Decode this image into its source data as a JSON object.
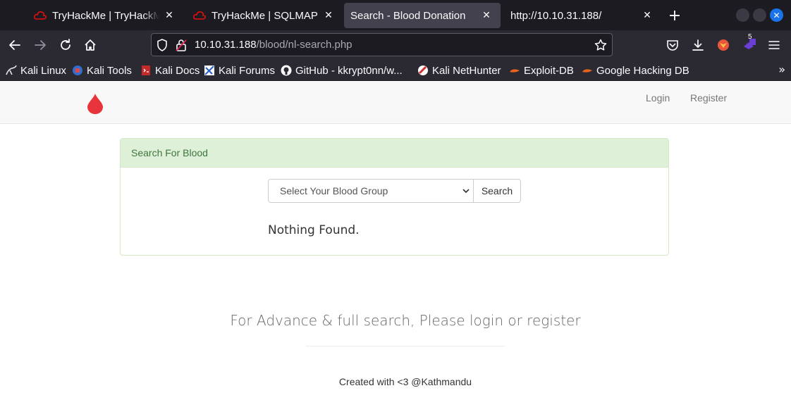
{
  "browser": {
    "tabs": [
      {
        "title": "TryHackMe | TryHackMe |",
        "active": false
      },
      {
        "title": "TryHackMe | SQLMAP",
        "active": false
      },
      {
        "title": "Search - Blood Donation",
        "active": true
      },
      {
        "title": "http://10.10.31.188/",
        "active": false
      }
    ],
    "url": {
      "host": "10.10.31.188",
      "path": "/blood/nl-search.php"
    },
    "extension_badge": "5",
    "bookmarks": [
      {
        "label": "Kali Linux",
        "icon": "kali-dragon-icon"
      },
      {
        "label": "Kali Tools",
        "icon": "kali-tools-icon"
      },
      {
        "label": "Kali Docs",
        "icon": "kali-docs-icon"
      },
      {
        "label": "Kali Forums",
        "icon": "kali-forums-icon"
      },
      {
        "label": "GitHub - kkrypt0nn/w...",
        "icon": "github-icon"
      },
      {
        "label": "Kali NetHunter",
        "icon": "nethunter-icon"
      },
      {
        "label": "Exploit-DB",
        "icon": "exploit-db-icon"
      },
      {
        "label": "Google Hacking DB",
        "icon": "ghdb-icon"
      }
    ]
  },
  "site": {
    "nav": {
      "login": "Login",
      "register": "Register"
    },
    "panel": {
      "heading": "Search For Blood",
      "select_placeholder": "Select Your Blood Group",
      "search_button": "Search",
      "result": "Nothing Found."
    },
    "advance_text": "For Advance & full search, Please login or register",
    "footer": "Created with <3 @Kathmandu"
  },
  "colors": {
    "accent": "#1a73e8",
    "drop": "#e8353b",
    "panel_head_bg": "#dff0d8",
    "panel_head_text": "#3c763d"
  }
}
